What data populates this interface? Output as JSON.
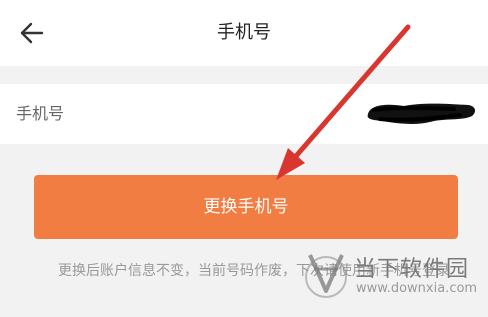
{
  "header": {
    "title": "手机号",
    "back_icon": "arrow-left-icon"
  },
  "phone_row": {
    "label": "手机号",
    "value_state": "redacted"
  },
  "primary_button": {
    "label": "更换手机号",
    "color": "#f27d43"
  },
  "hint": {
    "text": "更换后账户信息不变，当前号码作废，下次请使用新手机号登录"
  },
  "annotation": {
    "arrow_color": "#d9362f"
  },
  "watermark": {
    "brand": "当下软件园",
    "url": "www.downxia.com"
  }
}
